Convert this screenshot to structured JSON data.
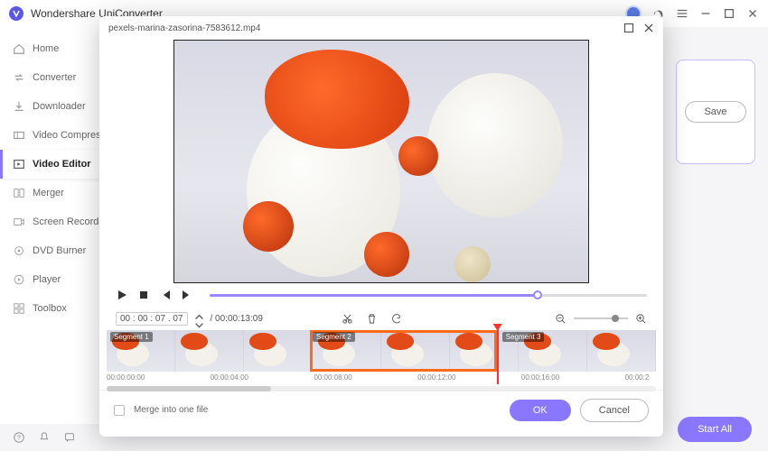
{
  "app": {
    "title": "Wondershare UniConverter"
  },
  "sidebar": {
    "items": [
      {
        "label": "Home"
      },
      {
        "label": "Converter"
      },
      {
        "label": "Downloader"
      },
      {
        "label": "Video Compressor"
      },
      {
        "label": "Video Editor"
      },
      {
        "label": "Merger"
      },
      {
        "label": "Screen Recorder"
      },
      {
        "label": "DVD Burner"
      },
      {
        "label": "Player"
      },
      {
        "label": "Toolbox"
      }
    ]
  },
  "rightpanel": {
    "save": "Save"
  },
  "startall": "Start All",
  "dialog": {
    "filename": "pexels-marina-zasorina-7583612.mp4",
    "timecode": "00 : 00 : 07 . 07",
    "duration": "/ 00:00:13:09",
    "segments": [
      "Segment 1",
      "Segment 2",
      "Segment 3"
    ],
    "ruler": [
      "00:00:00:00",
      "00:00:04:00",
      "00:00:08:00",
      "00:00:12:00",
      "00:00:16:00",
      "00:00:2"
    ],
    "merge_label": "Merge into one file",
    "ok": "OK",
    "cancel": "Cancel"
  }
}
